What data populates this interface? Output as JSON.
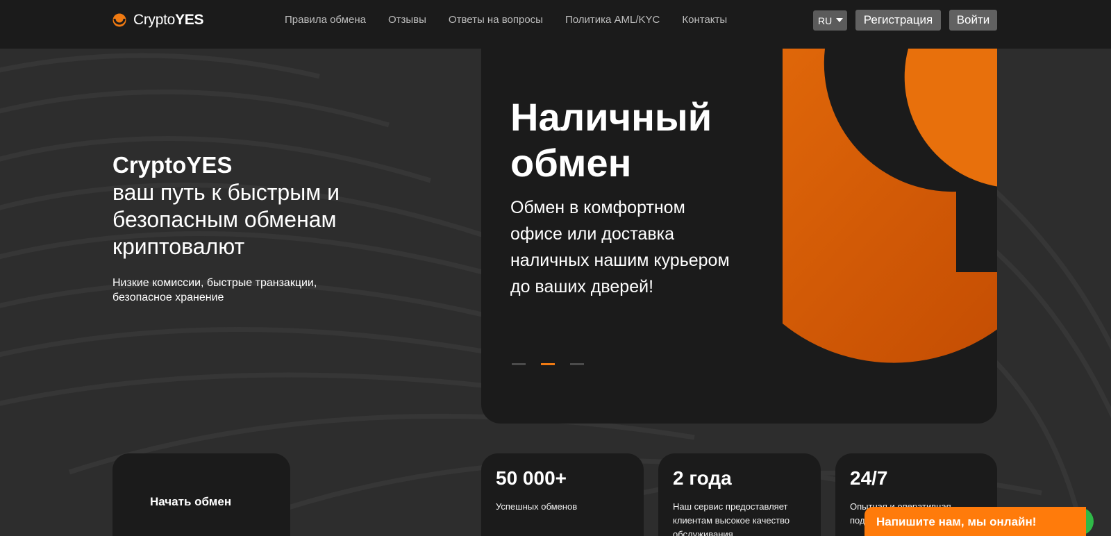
{
  "header": {
    "logo": {
      "prefix": "Crypto",
      "suffix": "YES"
    },
    "nav": [
      "Правила обмена",
      "Отзывы",
      "Ответы на вопросы",
      "Политика AML/KYC",
      "Контакты"
    ],
    "language": "RU",
    "register_label": "Регистрация",
    "login_label": "Войти"
  },
  "hero": {
    "brand": "CryptoYES",
    "tagline": "ваш путь к быстрым и безопасным обменам криптовалют",
    "subtitle": "Низкие комиссии, быстрые транзакции, безопасное хранение"
  },
  "slide": {
    "title_line1": "Наличный",
    "title_line2": "обмен",
    "description": "Обмен в комфортном офисе или доставка наличных нашим курьером до ваших дверей!",
    "total_slides": 3,
    "active_slide": 2
  },
  "start_card": {
    "label": "Начать обмен"
  },
  "stats": [
    {
      "value": "50 000+",
      "text": "Успешных обменов"
    },
    {
      "value": "2 года",
      "text": "Наш сервис предоставляет клиентам высокое качество обслуживания"
    },
    {
      "value": "24/7",
      "text": "Опытная и оперативная поддержка"
    }
  ],
  "chat": {
    "label": "Напишите нам, мы онлайн!"
  },
  "colors": {
    "accent": "#f07a12",
    "background": "#2d2d2d",
    "card": "#1b1b1b",
    "online": "#2fb948"
  }
}
